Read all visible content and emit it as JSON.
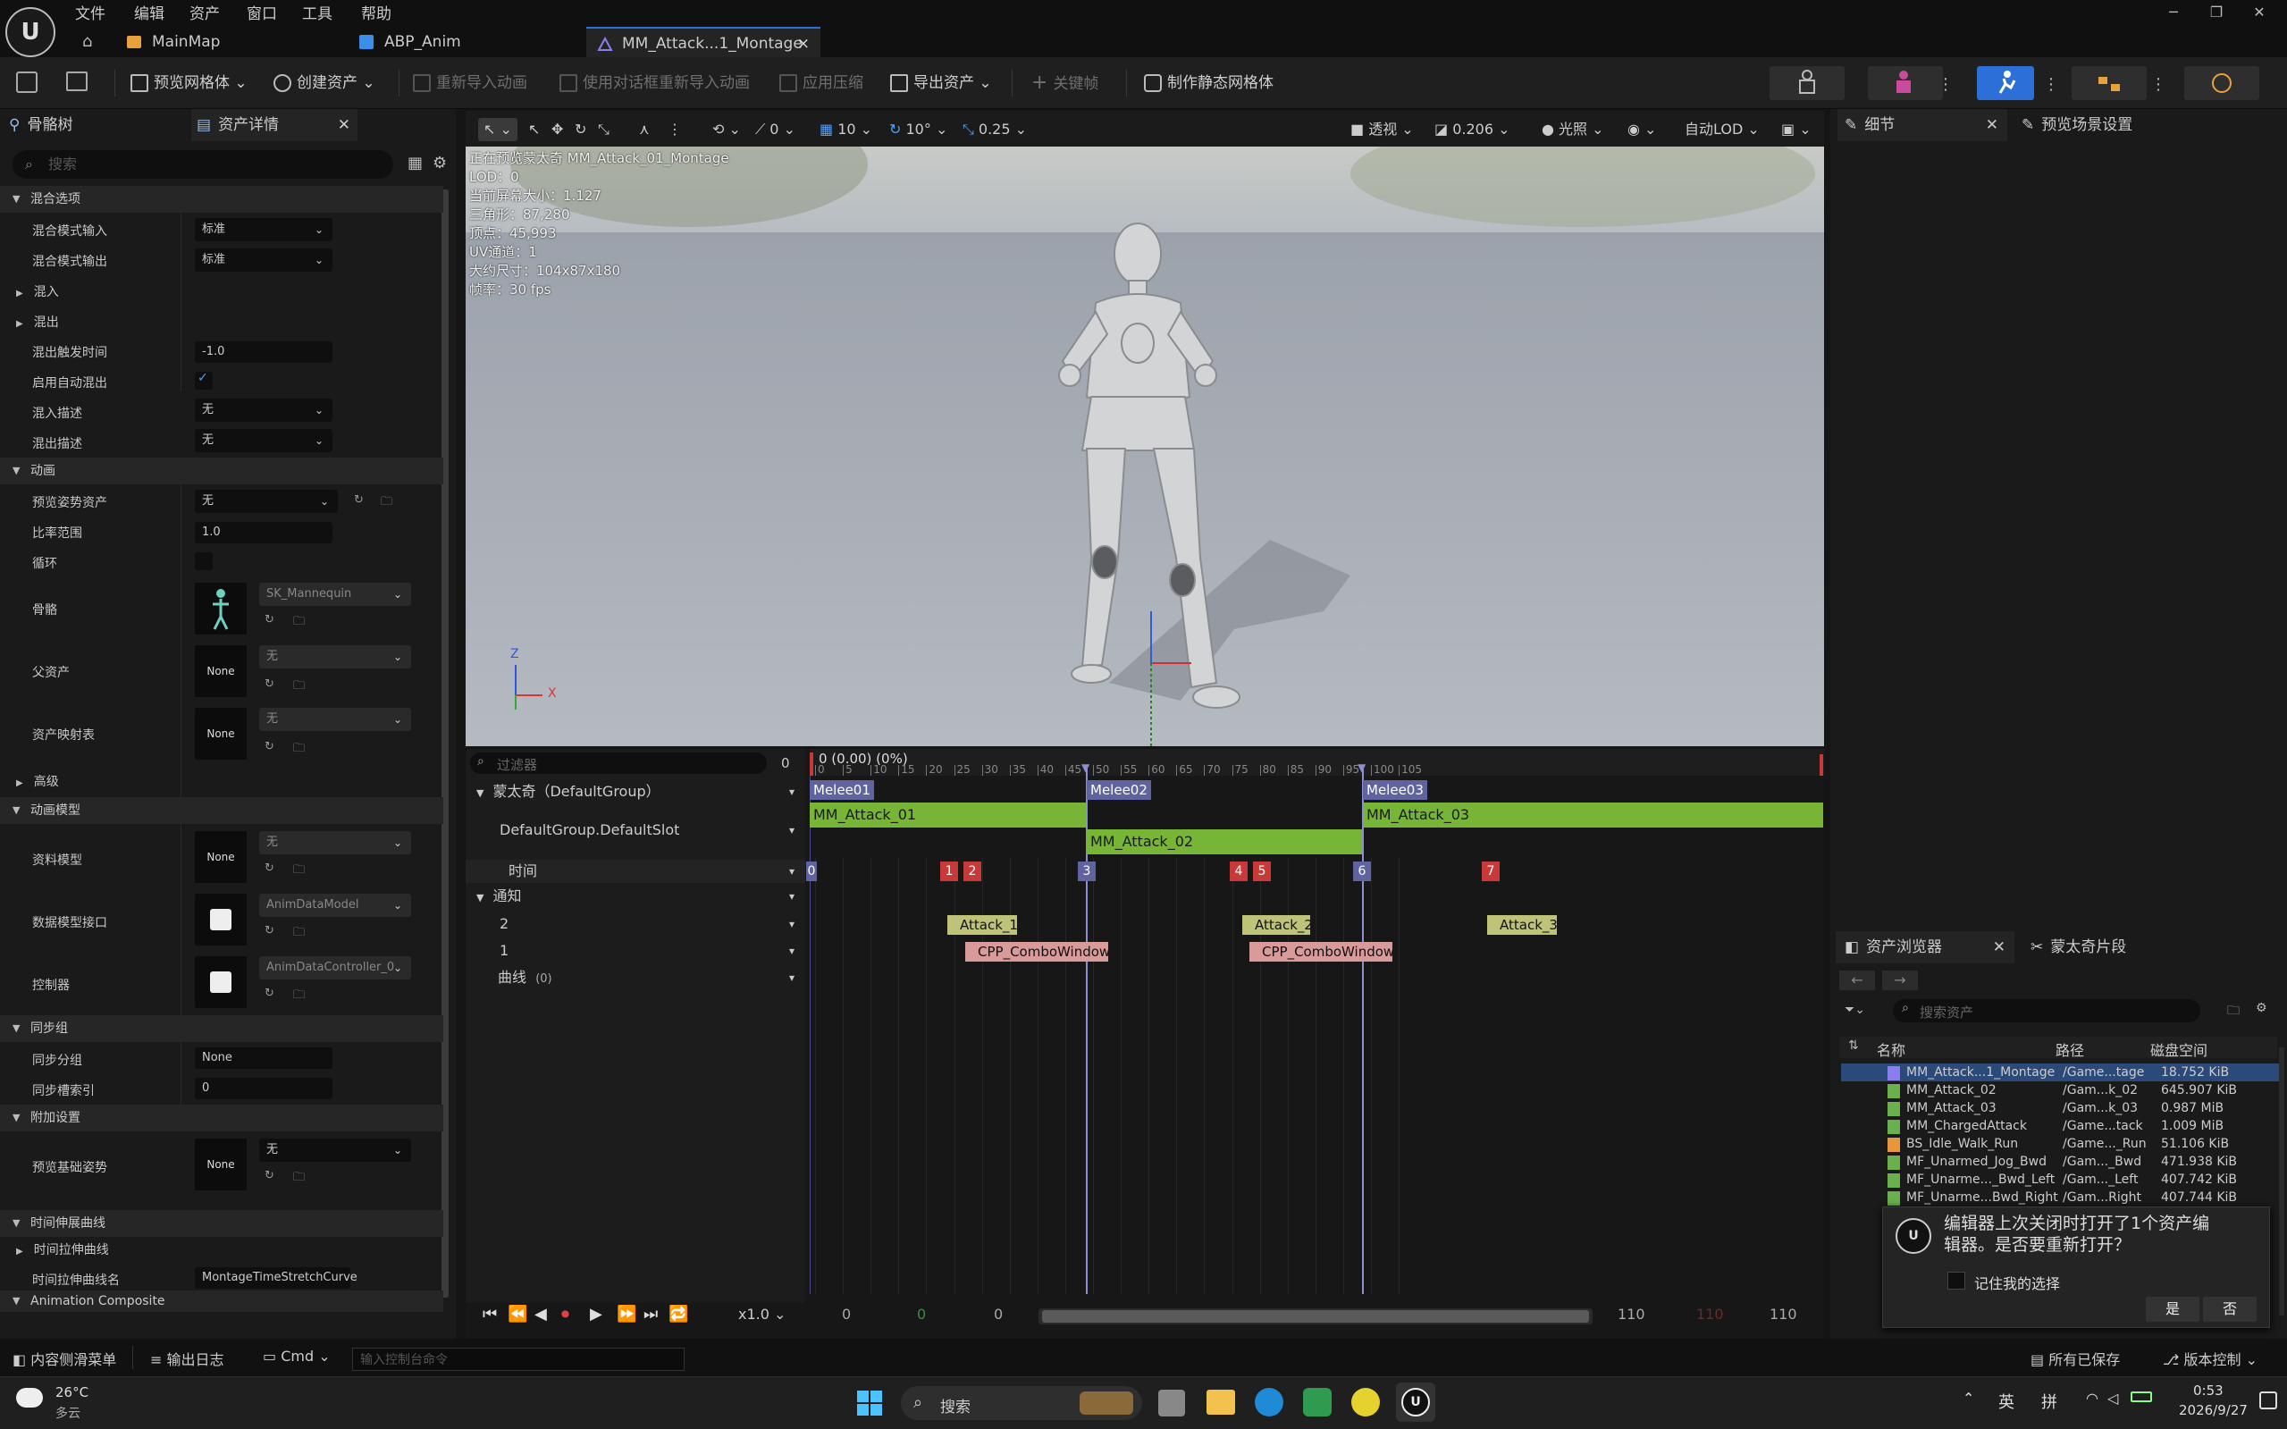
{
  "menubar": {
    "items": [
      "文件",
      "编辑",
      "资产",
      "窗口",
      "工具",
      "帮助"
    ]
  },
  "tabs": [
    {
      "label": "MainMap"
    },
    {
      "label": "ABP_Anim"
    },
    {
      "label": "MM_Attack...1_Montage",
      "close": "×"
    }
  ],
  "toolbar": {
    "preview_mesh": "预览网格体",
    "create_asset": "创建资产",
    "reimport_anim": "重新导入动画",
    "reimport_dialog": "使用对话框重新导入动画",
    "apply_compression": "应用压缩",
    "export_asset": "导出资产",
    "keyframe": "关键帧",
    "make_static_mesh": "制作静态网格体"
  },
  "left_panel": {
    "tab_skeleton": "骨骼树",
    "tab_asset_details": "资产详情",
    "search_placeholder": "搜索",
    "cat_blend_options": "混合选项",
    "blend_mode_in_label": "混合模式输入",
    "blend_mode_in": "标准",
    "blend_mode_out_label": "混合模式输出",
    "blend_mode_out": "标准",
    "blend_in": "混入",
    "blend_out": "混出",
    "blend_out_trigger_label": "混出触发时间",
    "blend_out_trigger": "-1.0",
    "enable_auto_blend_label": "启用自动混出",
    "blend_in_desc_label": "混入描述",
    "blend_in_desc": "无",
    "blend_out_desc_label": "混出描述",
    "blend_out_desc": "无",
    "cat_animation": "动画",
    "preview_pose_label": "预览姿势资产",
    "preview_pose": "无",
    "rate_scale_label": "比率范围",
    "rate_scale": "1.0",
    "loop_label": "循环",
    "skeleton_label": "骨骼",
    "skeleton": "SK_Mannequin",
    "parent_asset_label": "父资产",
    "parent_asset": "无",
    "none_thumb": "None",
    "asset_mapping_label": "资产映射表",
    "asset_mapping": "无",
    "advanced": "高级",
    "cat_anim_model": "动画模型",
    "data_model_label": "资料模型",
    "data_model": "无",
    "data_model_interface_label": "数据模型接口",
    "data_model_interface": "AnimDataModel",
    "controller_label": "控制器",
    "controller": "AnimDataController_0",
    "cat_sync_group": "同步组",
    "sync_group_label": "同步分组",
    "sync_group": "None",
    "sync_marker_label": "同步槽索引",
    "sync_marker": "0",
    "cat_additional": "附加设置",
    "preview_base_pose_label": "预览基础姿势",
    "preview_base_pose": "无",
    "cat_time_stretch": "时间伸展曲线",
    "time_stretch_curve": "时间拉伸曲线",
    "time_stretch_curve_name_label": "时间拉伸曲线名",
    "time_stretch_curve_name": "MontageTimeStretchCurve",
    "cat_anim_composite": "Animation Composite"
  },
  "viewport": {
    "toolbar": {
      "snap_angle": "0",
      "grid": "10",
      "rot_grid": "10°",
      "scale_grid": "0.25",
      "perspective": "透视",
      "fov": "0.206",
      "lighting": "光照",
      "auto_lod": "自动LOD"
    },
    "info": [
      "正在预览蒙太奇 MM_Attack_01_Montage",
      "LOD：0",
      "当前屏幕大小：1.127",
      "三角形：87,280",
      "顶点：45,993",
      "UV通道：1",
      "大约尺寸：104x87x180",
      "帧率：30 fps"
    ],
    "axis_z": "Z",
    "axis_x": "X"
  },
  "timeline": {
    "filter_placeholder": "过滤器",
    "filter_count": "0",
    "playhead_label": "0 (0.00) (0%)",
    "ruler_ticks": [
      "0",
      "5",
      "10",
      "15",
      "20",
      "25",
      "30",
      "35",
      "40",
      "45",
      "50",
      "55",
      "60",
      "65",
      "70",
      "75",
      "80",
      "85",
      "90",
      "95",
      "100",
      "105"
    ],
    "montage_group": "蒙太奇（DefaultGroup）",
    "slot": "DefaultGroup.DefaultSlot",
    "time": "时间",
    "notifies": "通知",
    "notify_track_2": "2",
    "notify_track_1": "1",
    "curves": "曲线",
    "curves_count": "(0)",
    "sections": [
      {
        "name": "Melee01"
      },
      {
        "name": "Melee02"
      },
      {
        "name": "Melee03"
      }
    ],
    "segments": [
      "MM_Attack_01",
      "MM_Attack_02",
      "MM_Attack_03"
    ],
    "markers": [
      "0",
      "1",
      "2",
      "3",
      "4",
      "5",
      "6",
      "7"
    ],
    "notifies_top": [
      "Attack_1",
      "Attack_2",
      "Attack_3"
    ],
    "notifies_bottom": [
      "CPP_ComboWindow",
      "CPP_ComboWindow"
    ],
    "speed": "x1.0",
    "frame_start": "0",
    "frame_current": "0",
    "frame_view": "0",
    "frame_end_view": "110",
    "frame_end_red": "110",
    "frame_end": "110"
  },
  "right_panel": {
    "tab_details": "细节",
    "tab_preview_scene": "预览场景设置",
    "tab_asset_browser": "资产浏览器",
    "tab_montage_clips": "蒙太奇片段",
    "search_placeholder": "搜索资产",
    "col_name": "名称",
    "col_path": "路径",
    "col_disk": "磁盘空间",
    "assets": [
      {
        "name": "MM_Attack...1_Montage",
        "path": "/Game...tage",
        "size": "18.752 KiB"
      },
      {
        "name": "MM_Attack_02",
        "path": "/Gam...k_02",
        "size": "645.907 KiB"
      },
      {
        "name": "MM_Attack_03",
        "path": "/Gam...k_03",
        "size": "0.987 MiB"
      },
      {
        "name": "MM_ChargedAttack",
        "path": "/Game...tack",
        "size": "1.009 MiB"
      },
      {
        "name": "BS_Idle_Walk_Run",
        "path": "/Game..._Run",
        "size": "51.106 KiB"
      },
      {
        "name": "MF_Unarmed_Jog_Bwd",
        "path": "/Gam..._Bwd",
        "size": "471.938 KiB"
      },
      {
        "name": "MF_Unarme..._Bwd_Left",
        "path": "/Gam..._Left",
        "size": "407.742 KiB"
      },
      {
        "name": "MF_Unarme...Bwd_Right",
        "path": "/Gam...Right",
        "size": "407.744 KiB"
      }
    ],
    "dialog": {
      "message": "编辑器上次关闭时打开了1个资产编辑器。是否要重新打开？",
      "remember": "记住我的选择",
      "yes": "是",
      "no": "否"
    }
  },
  "statusbar": {
    "content_drawer": "内容侧滑菜单",
    "output_log": "输出日志",
    "cmd": "Cmd",
    "console_placeholder": "输入控制台命令",
    "all_saved": "所有已保存",
    "source_control": "版本控制"
  },
  "taskbar": {
    "temperature": "26°C",
    "weather": "多云",
    "search": "搜索",
    "ime_lang": "英",
    "ime_mode": "拼",
    "time": "0:53",
    "date": "2026/9/27"
  },
  "colors": {
    "accent_blue": "#2d6fd8",
    "segment_green": "#76b536",
    "section_purple": "#5f63a0",
    "marker_red": "#c83a3a"
  }
}
